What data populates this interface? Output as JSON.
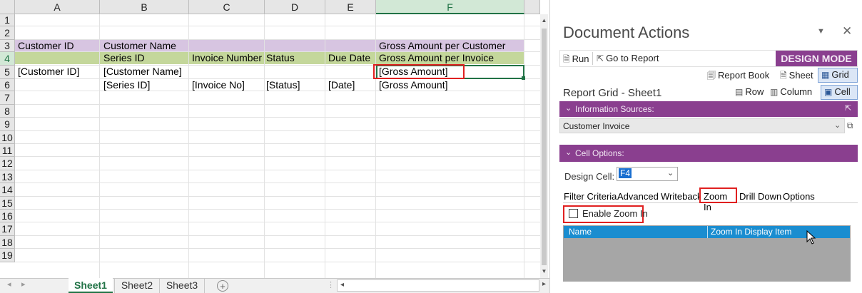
{
  "sheet": {
    "columns": [
      "A",
      "B",
      "C",
      "D",
      "E",
      "F"
    ],
    "rows": [
      "1",
      "2",
      "3",
      "4",
      "5",
      "6",
      "7",
      "8",
      "9",
      "10",
      "11",
      "12",
      "13",
      "14",
      "15",
      "16",
      "17",
      "18",
      "19"
    ],
    "row2": {
      "A": "Customer ID",
      "B": "Customer Name",
      "F": "Gross Amount per Customer"
    },
    "row3": {
      "B": "Series ID",
      "C": "Invoice Number",
      "D": "Status",
      "E": "Due Date",
      "F": "Gross Amount per Invoice"
    },
    "row4": {
      "A": "[Customer ID]",
      "B": "[Customer Name]",
      "F": "[Gross Amount]"
    },
    "row5": {
      "B": "[Series ID]",
      "C": "[Invoice No]",
      "D": "[Status]",
      "E": "[Date]",
      "F": "[Gross Amount]"
    },
    "colors": {
      "row2": "#d7c5e1",
      "row3": "#c4d79b",
      "selected": "#217346",
      "highlight": "#e02020"
    }
  },
  "tabs": {
    "sheets": [
      "Sheet1",
      "Sheet2",
      "Sheet3"
    ],
    "add": "+"
  },
  "pane": {
    "title": "Document Actions",
    "run": "Run",
    "go_to_report": "Go to Report",
    "mode": "DESIGN MODE",
    "report_book": "Report Book",
    "sheet": "Sheet",
    "grid": "Grid",
    "report_grid_label": "Report Grid - Sheet1",
    "row": "Row",
    "column": "Column",
    "cell": "Cell",
    "info_sources": "Information Sources:",
    "source_value": "Customer Invoice",
    "cell_options": "Cell Options:",
    "design_cell_label": "Design Cell:",
    "design_cell_value": "F4",
    "option_tabs": [
      "Filter Criteria",
      "Advanced",
      "Writeback",
      "Zoom In",
      "Drill Down",
      "Options"
    ],
    "enable_zoom": "Enable Zoom In",
    "table_headers": [
      "Name",
      "Zoom In Display Item"
    ],
    "colors": {
      "accent": "#8a3f8f",
      "table_header": "#1a8dd0",
      "table_body": "#a6a6a6"
    }
  }
}
